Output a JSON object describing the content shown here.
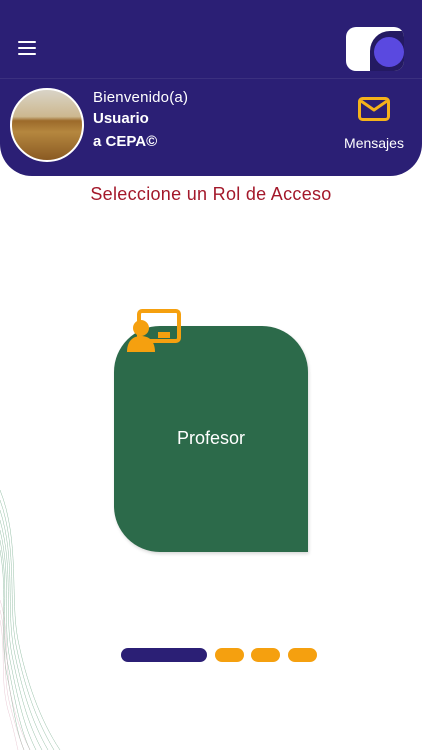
{
  "header": {
    "welcome": "Bienvenido(a)",
    "user": "Usuario",
    "org": "a CEPA©",
    "messages_label": "Mensajes",
    "menu_icon": "hamburger-menu-icon",
    "mail_icon": "envelope-icon"
  },
  "main": {
    "title": "Seleccione un Rol de Acceso",
    "roles": [
      {
        "label": "Profesor",
        "icon": "teacher-board-icon"
      }
    ]
  },
  "pager": {
    "pages": 4,
    "active_index": 0
  },
  "colors": {
    "header_bg": "#2b1f75",
    "title": "#a3182a",
    "card": "#2c6a4a",
    "accent": "#f5a00f",
    "logo_accent": "#5a49e0"
  }
}
